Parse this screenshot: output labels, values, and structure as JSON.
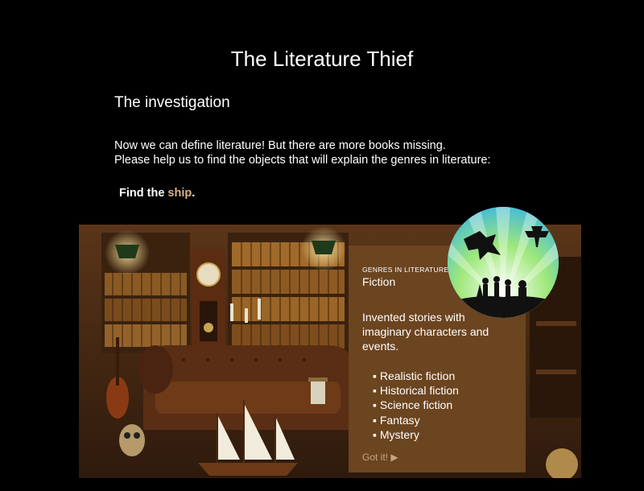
{
  "header": {
    "title": "The Literature Thief",
    "subtitle": "The investigation"
  },
  "intro": {
    "line1": "Now we can define literature! But there are more books missing.",
    "line2": "Please help us to find the objects that will explain the genres in literature:"
  },
  "task": {
    "prefix": "Find the",
    "target": "ship",
    "suffix": "."
  },
  "panel": {
    "kicker": "GENRES IN LITERATURE",
    "heading": "Fiction",
    "description": "Invented stories with imaginary characters and events.",
    "items": [
      "Realistic fiction",
      "Historical fiction",
      "Science fiction",
      "Fantasy",
      "Mystery"
    ],
    "button": "Got it! ▶"
  },
  "colors": {
    "background": "#000000",
    "panel": "#6b4420",
    "highlight": "#d9b48a",
    "button_text": "#c7a584"
  },
  "icons": {
    "badge": "fantasy-genre-badge-icon"
  }
}
